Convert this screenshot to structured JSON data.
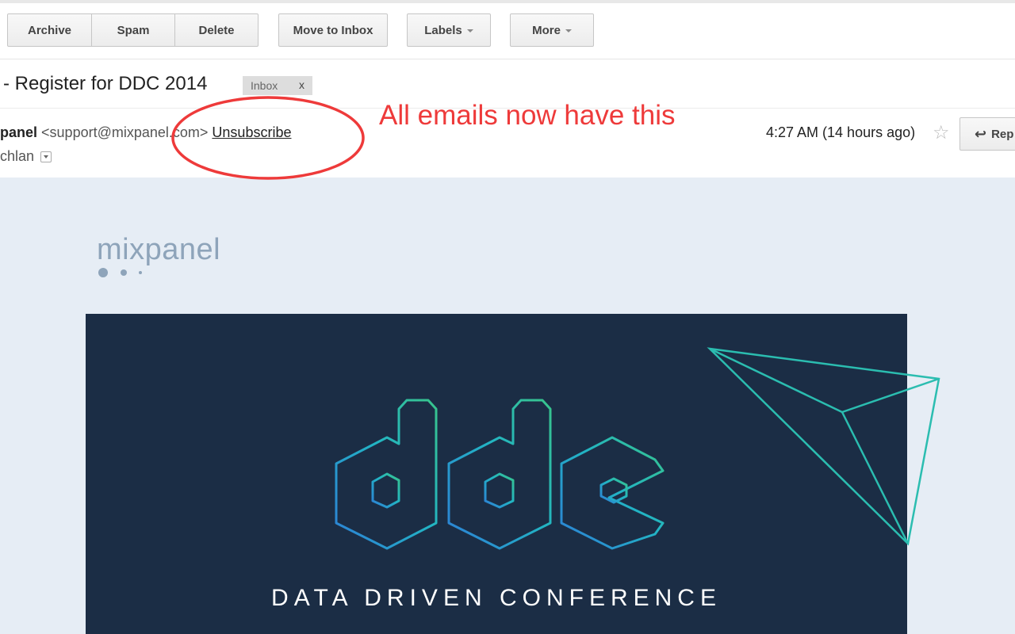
{
  "toolbar": {
    "archive": "Archive",
    "spam": "Spam",
    "delete": "Delete",
    "move_to_inbox": "Move to Inbox",
    "labels": "Labels",
    "more": "More"
  },
  "subject": {
    "text": "- Register for DDC 2014",
    "label": "Inbox",
    "label_remove": "x"
  },
  "message": {
    "sender_name": "panel",
    "sender_email": "<support@mixpanel.com>",
    "unsubscribe": "Unsubscribe",
    "recipient": "chlan",
    "time": "4:27 AM (14 hours ago)",
    "star_icon": "star-icon",
    "reply_label": "Rep"
  },
  "annotation": {
    "text": "All emails now have this",
    "color": "#ee3a3a"
  },
  "email_content": {
    "logo": "mixpanel",
    "banner_title": "DATA DRIVEN CONFERENCE",
    "banner_mark": "ddc",
    "banner_color": "#1b2d45",
    "accent_color": "#2bbdb0"
  }
}
